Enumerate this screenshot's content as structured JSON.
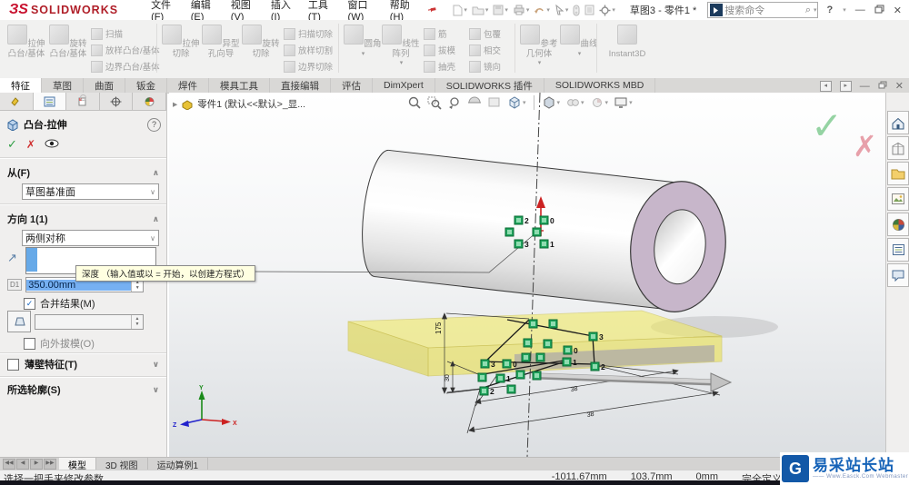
{
  "titlebar": {
    "logo_mark": "ЗS",
    "logo_text": "SOLIDWORKS",
    "menus": [
      "文件(F)",
      "编辑(E)",
      "视图(V)",
      "插入(I)",
      "工具(T)",
      "窗口(W)",
      "帮助(H)"
    ],
    "doc_title": "草图3 - 零件1 *",
    "search_placeholder": "搜索命令",
    "help_label": "?",
    "minimize_glyph": "—",
    "close_glyph": "✕"
  },
  "ribbon": {
    "g1_big": [
      "拉伸凸台/基体",
      "旋转凸台/基体"
    ],
    "g1_small": [
      "扫描",
      "放样凸台/基体",
      "边界凸台/基体"
    ],
    "g2_big": [
      "拉伸切除",
      "异型孔向导",
      "旋转切除"
    ],
    "g2_small": [
      "扫描切除",
      "放样切割",
      "边界切除"
    ],
    "g3_big": [
      "圆角",
      "线性阵列"
    ],
    "g3_small_a": [
      "筋",
      "拔模",
      "抽壳"
    ],
    "g3_small_b": [
      "包覆",
      "相交",
      "镜向"
    ],
    "g4_big": [
      "参考几何体",
      "曲线"
    ],
    "g5_label": "Instant3D"
  },
  "tabs": [
    "特征",
    "草图",
    "曲面",
    "钣金",
    "焊件",
    "模具工具",
    "直接编辑",
    "评估",
    "DimXpert",
    "SOLIDWORKS 插件",
    "SOLIDWORKS MBD"
  ],
  "panel": {
    "title": "凸台-拉伸",
    "ok_glyph": "✓",
    "cancel_glyph": "✗",
    "from_label": "从(F)",
    "from_value": "草图基准面",
    "dir_label": "方向 1(1)",
    "dir_value": "两侧对称",
    "dir_arrow_glyph": "↗",
    "depth_value": "350.00mm",
    "merge_label": "合并结果(M)",
    "merge_check": "✓",
    "outward_label": "向外拔模(O)",
    "thin_label": "薄壁特征(T)",
    "profiles_label": "所选轮廓(S)",
    "collapse_glyph": "∧",
    "expand_glyph": "∨"
  },
  "tooltip_text": "深度 （输入值或以 = 开始，以创建方程式）",
  "graphics": {
    "breadcrumb_arrow": "▸",
    "breadcrumb": "零件1 (默认<<默认>_显...",
    "confirm_ok_glyph": "✓",
    "confirm_cancel_glyph": "✗",
    "handles": [
      "2",
      "0",
      "3",
      "1",
      "3",
      "0",
      "1",
      "2",
      "3",
      "0",
      "1",
      "2"
    ],
    "dims": {
      "d1": "175",
      "d2": "30",
      "d3": "38",
      "d4": "38"
    },
    "triad": {
      "x": "X",
      "y": "Y",
      "z": "Z"
    }
  },
  "taskpane_close_glyph": "✕",
  "bottom_tabs": [
    "模型",
    "3D 视图",
    "运动算例1"
  ],
  "statusbar": {
    "hint": "选择一把手来修改参数",
    "coord_x": "-1011.67mm",
    "coord_y": "103.7mm",
    "coord_z": "0mm",
    "state": "完全定义"
  },
  "watermark": {
    "logo_glyph": "G",
    "title": "易采站长站",
    "subtitle": "—— Www.Easck.Com Webmaster"
  },
  "colors": {
    "accent_blue": "#2a7ecc",
    "handle_green": "#1fa35c",
    "preview_yellow": "#f2ea5a",
    "logo_red": "#c8102e",
    "watermark_blue": "#1258a7",
    "bore_mauve": "#c7b6ca"
  }
}
